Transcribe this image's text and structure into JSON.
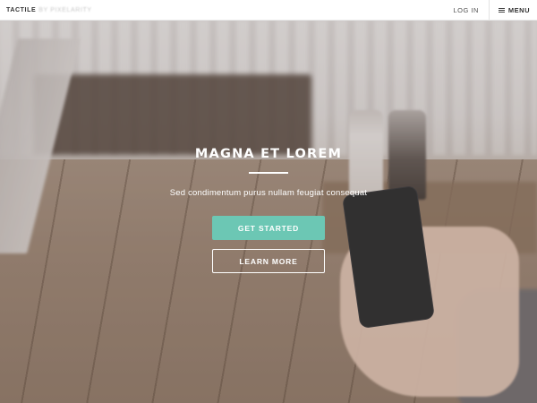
{
  "header": {
    "brand_name": "TACTILE",
    "brand_suffix": "BY PIXELARITY",
    "login_label": "LOG IN",
    "menu_label": "MENU",
    "menu_icon": "hamburger-icon"
  },
  "hero": {
    "title": "MAGNA ET LOREM",
    "subtitle": "Sed condimentum purus nullam feugiat consequat",
    "primary_button": "GET STARTED",
    "secondary_button": "LEARN MORE"
  },
  "colors": {
    "accent": "#6cc7b4",
    "header_bg": "#ffffff",
    "text_light": "#ffffff"
  }
}
